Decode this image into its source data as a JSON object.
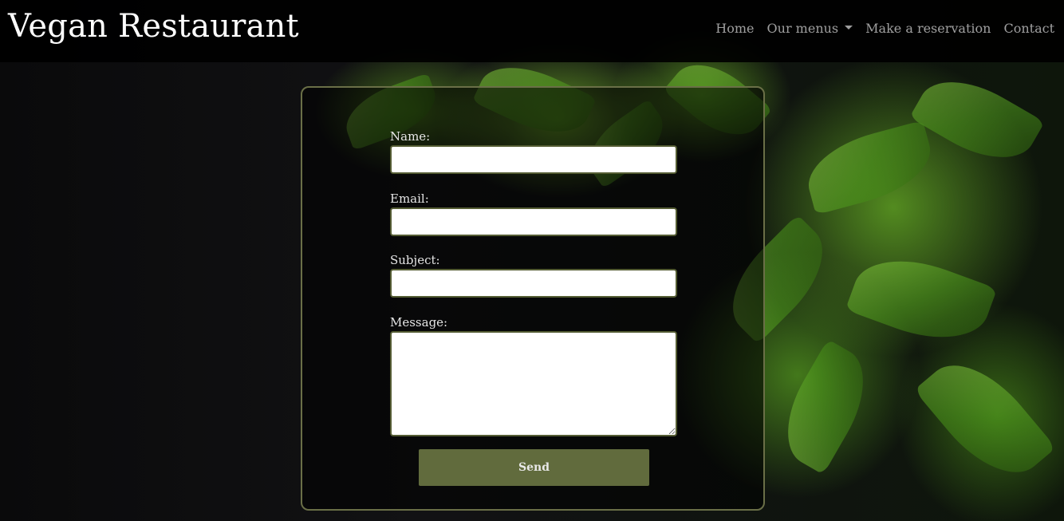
{
  "navbar": {
    "brand": "Vegan Restaurant",
    "items": [
      {
        "label": "Home"
      },
      {
        "label": "Our menus"
      },
      {
        "label": "Make a reservation"
      },
      {
        "label": "Contact"
      }
    ]
  },
  "form": {
    "name_label": "Name:",
    "name_value": "",
    "email_label": "Email:",
    "email_value": "",
    "subject_label": "Subject:",
    "subject_value": "",
    "message_label": "Message:",
    "message_value": "",
    "send_label": "Send"
  },
  "colors": {
    "navbar_bg": "#000000",
    "card_border": "#6a6f47",
    "input_border": "#545c33",
    "button_bg": "#616b3d"
  },
  "icons": {
    "dropdown": "caret-down-icon"
  }
}
